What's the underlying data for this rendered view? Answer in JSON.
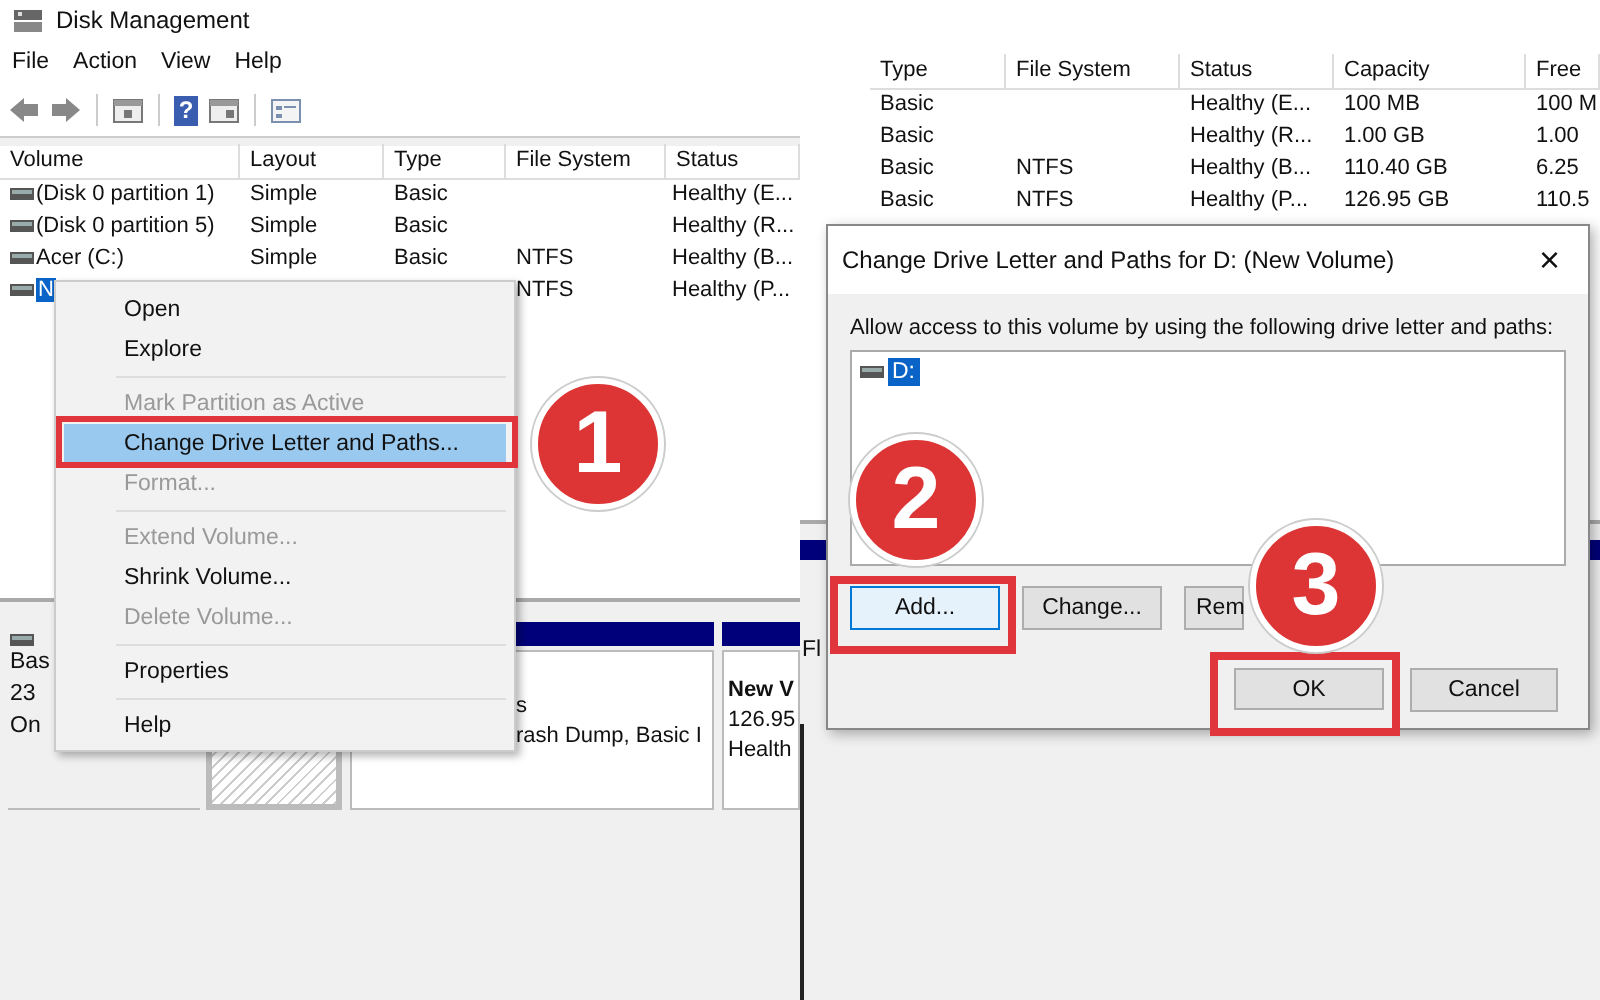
{
  "left_screenshot": {
    "window": {
      "title": "Disk Management"
    },
    "menu": [
      "File",
      "Action",
      "View",
      "Help"
    ],
    "toolbar": [
      {
        "kind": "back"
      },
      {
        "kind": "forward"
      },
      {
        "kind": "pane"
      },
      {
        "kind": "help",
        "glyph": "?"
      },
      {
        "kind": "pane2"
      },
      {
        "kind": "list"
      }
    ],
    "table": {
      "columns": [
        "Volume",
        "Layout",
        "Type",
        "File System",
        "Status"
      ],
      "rows": [
        {
          "volume": "(Disk 0 partition 1)",
          "layout": "Simple",
          "type": "Basic",
          "status": "Healthy (E...",
          "selected": false
        },
        {
          "volume": "(Disk 0 partition 5)",
          "layout": "Simple",
          "type": "Basic",
          "status": "Healthy (R...",
          "selected": false
        },
        {
          "volume": "Acer (C:)",
          "layout": "Simple",
          "type": "Basic",
          "file_system": "NTFS",
          "status": "Healthy (B...",
          "selected": false
        },
        {
          "volume": "N",
          "file_system": "NTFS",
          "status": "Healthy (P...",
          "selected": true
        }
      ]
    },
    "disk": {
      "lines": [
        "Bas",
        "23",
        "On"
      ]
    },
    "partitions": [
      {
        "kind": "unallocated"
      },
      {
        "kind": "volume",
        "lines": [
          "s",
          "rash Dump, Basic I"
        ]
      },
      {
        "kind": "volume",
        "title": "New V",
        "lines": [
          "126.95",
          "Health"
        ]
      }
    ],
    "context_menu": [
      {
        "label": "Open",
        "disabled": false,
        "selected": false,
        "separator_before": false
      },
      {
        "label": "Explore",
        "disabled": false,
        "selected": false,
        "separator_before": false
      },
      {
        "label": "Mark Partition as Active",
        "disabled": true,
        "selected": false,
        "separator_before": true
      },
      {
        "label": "Change Drive Letter and Paths...",
        "disabled": false,
        "selected": true,
        "separator_before": false
      },
      {
        "label": "Format...",
        "disabled": true,
        "selected": false,
        "separator_before": false
      },
      {
        "label": "Extend Volume...",
        "disabled": true,
        "selected": false,
        "separator_before": true
      },
      {
        "label": "Shrink Volume...",
        "disabled": false,
        "selected": false,
        "separator_before": false
      },
      {
        "label": "Delete Volume...",
        "disabled": true,
        "selected": false,
        "separator_before": false
      },
      {
        "label": "Properties",
        "disabled": false,
        "selected": false,
        "separator_before": true
      },
      {
        "label": "Help",
        "disabled": false,
        "selected": false,
        "separator_before": true
      }
    ],
    "step_badge": "1"
  },
  "right_screenshot": {
    "table": {
      "columns": [
        "Type",
        "File System",
        "Status",
        "Capacity",
        "Free"
      ],
      "rows": [
        {
          "type": "Basic",
          "status": "Healthy (E...",
          "capacity": "100 MB",
          "column_5": "100 M"
        },
        {
          "type": "Basic",
          "status": "Healthy (R...",
          "capacity": "1.00 GB",
          "column_5": "1.00"
        },
        {
          "type": "Basic",
          "file_system": "NTFS",
          "status": "Healthy (B...",
          "capacity": "110.40 GB",
          "column_5": "6.25"
        },
        {
          "type": "Basic",
          "file_system": "NTFS",
          "status": "Healthy (P...",
          "capacity": "126.95 GB",
          "column_5": "110.5"
        }
      ]
    },
    "disk_text": "Fl",
    "dialog": {
      "title": "Change Drive Letter and Paths for D: (New Volume)",
      "close": "×",
      "prompt": "Allow access to this volume by using the following drive letter and paths:",
      "paths": [
        {
          "label": "D:",
          "selected": true
        }
      ],
      "buttons": [
        {
          "label": "Add...",
          "kind": "add"
        },
        {
          "label": "Change...",
          "kind": "change"
        },
        {
          "label": "Rem",
          "kind": "remove"
        },
        {
          "label": "OK",
          "kind": "ok"
        },
        {
          "label": "Cancel",
          "kind": "cancel"
        }
      ]
    },
    "step_badges": [
      "2",
      "3"
    ]
  }
}
